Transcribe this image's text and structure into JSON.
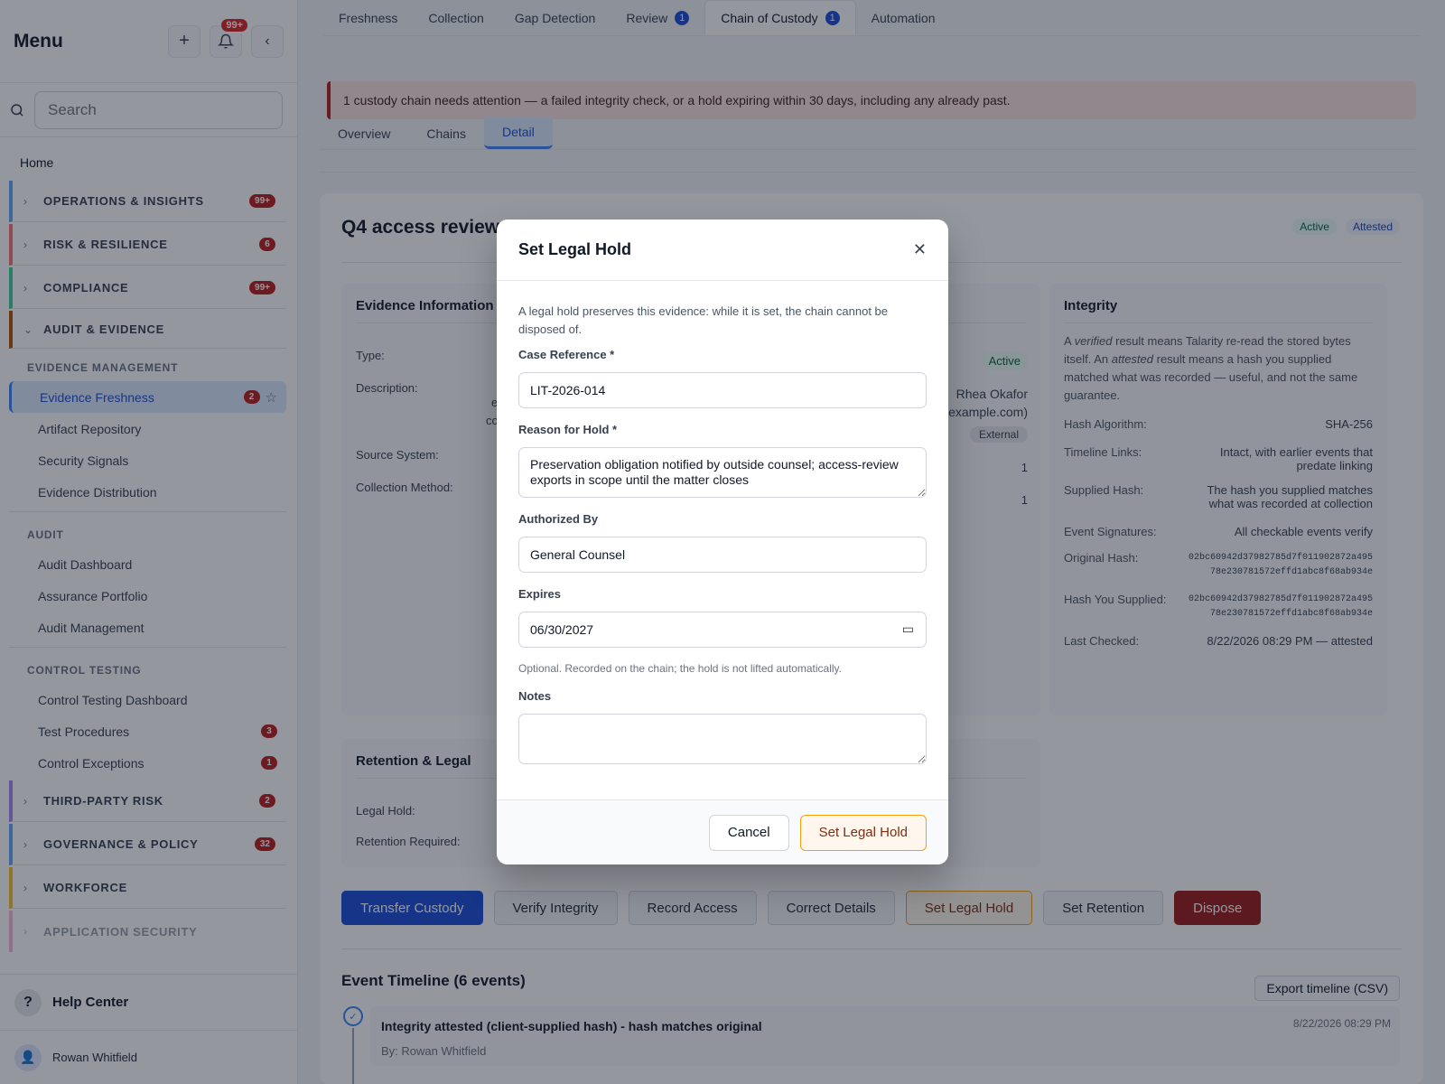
{
  "sidebar": {
    "title": "Menu",
    "notif_badge": "99+",
    "search_placeholder": "Search",
    "home": "Home",
    "groups": {
      "ops": {
        "label": "OPERATIONS & INSIGHTS",
        "badge": "99+",
        "color": "#60a5fa"
      },
      "risk": {
        "label": "RISK & RESILIENCE",
        "badge": "6",
        "color": "#f87171"
      },
      "compliance": {
        "label": "COMPLIANCE",
        "badge": "99+",
        "color": "#34d399"
      },
      "audit": {
        "label": "AUDIT & EVIDENCE",
        "color": "#b45309"
      },
      "tpr": {
        "label": "THIRD-PARTY RISK",
        "badge": "2",
        "color": "#a78bfa"
      },
      "gov": {
        "label": "GOVERNANCE & POLICY",
        "badge": "32",
        "color": "#60a5fa"
      },
      "work": {
        "label": "WORKFORCE",
        "color": "#fbbf24"
      },
      "appsec": {
        "label": "APPLICATION SECURITY",
        "color": "#f472b6"
      }
    },
    "sections": {
      "evidence": "EVIDENCE MANAGEMENT",
      "audit": "AUDIT",
      "ct": "CONTROL TESTING"
    },
    "items": {
      "freshness": {
        "label": "Evidence Freshness",
        "badge": "2"
      },
      "artifact": "Artifact Repository",
      "signals": "Security Signals",
      "distribution": "Evidence Distribution",
      "audit_dash": "Audit Dashboard",
      "assurance": "Assurance Portfolio",
      "audit_mgmt": "Audit Management",
      "ct_dash": "Control Testing Dashboard",
      "procedures": {
        "label": "Test Procedures",
        "badge": "3"
      },
      "exceptions": {
        "label": "Control Exceptions",
        "badge": "1"
      }
    },
    "help": "Help Center",
    "user": "Rowan Whitfield"
  },
  "tabs": [
    {
      "label": "Freshness"
    },
    {
      "label": "Collection"
    },
    {
      "label": "Gap Detection"
    },
    {
      "label": "Review",
      "count": "1"
    },
    {
      "label": "Chain of Custody",
      "count": "1"
    },
    {
      "label": "Automation"
    }
  ],
  "alert": "1 custody chain needs attention — a failed integrity check, or a hold expiring within 30 days, including any already past.",
  "subtabs": [
    "Overview",
    "Chains",
    "Detail"
  ],
  "chain": {
    "title": "Q4 access review",
    "pills": [
      "Active",
      "Attested"
    ],
    "evidence_panel": {
      "title": "Evidence Information",
      "type_label": "Type:",
      "desc_label": "Description:",
      "source_label": "Source System:",
      "method_label": "Collection Method:",
      "status": "Active",
      "owner": "Rhea Okafor",
      "email_frag": "example.com)",
      "tag": "External",
      "frag_e": "e",
      "frag_co": "co",
      "n1": "1",
      "n2": "1"
    },
    "integrity": {
      "title": "Integrity",
      "intro_a": "A ",
      "intro_verified": "verified",
      "intro_b": " result means Talarity re-read the stored bytes itself. An ",
      "intro_attested": "attested",
      "intro_c": " result means a hash you supplied matched what was recorded — useful, and not the same guarantee.",
      "hash_alg_label": "Hash Algorithm:",
      "hash_alg": "SHA-256",
      "links_label": "Timeline Links:",
      "links": "Intact, with earlier events that predate linking",
      "supplied_label": "Supplied Hash:",
      "supplied": "The hash you supplied matches what was recorded at collection",
      "sig_label": "Event Signatures:",
      "sig": "All checkable events verify",
      "orig_label": "Original Hash:",
      "orig_1": "02bc60942d37982785d7f011902872a495",
      "orig_2": "78e230781572effd1abc8f68ab934e",
      "you_label": "Hash You Supplied:",
      "you_1": "02bc60942d37982785d7f011902872a495",
      "you_2": "78e230781572effd1abc8f68ab934e",
      "last_label": "Last Checked:",
      "last": "8/22/2026 08:29 PM — attested"
    },
    "retention": {
      "title": "Retention & Legal",
      "hold_label": "Legal Hold:",
      "req_label": "Retention Required:"
    },
    "actions": [
      "Transfer Custody",
      "Verify Integrity",
      "Record Access",
      "Correct Details",
      "Set Legal Hold",
      "Set Retention",
      "Dispose"
    ],
    "timeline": {
      "title": "Event Timeline (6 events)",
      "export": "Export timeline (CSV)",
      "event_title": "Integrity attested (client-supplied hash) - hash matches original",
      "event_by": "By: Rowan Whitfield",
      "event_ts": "8/22/2026 08:29 PM"
    }
  },
  "modal": {
    "title": "Set Legal Hold",
    "intro": "A legal hold preserves this evidence: while it is set, the chain cannot be disposed of.",
    "case_label": "Case Reference *",
    "case_value": "LIT-2026-014",
    "reason_label": "Reason for Hold *",
    "reason_value": "Preservation obligation notified by outside counsel; access-review exports in scope until the matter closes",
    "auth_label": "Authorized By",
    "auth_value": "General Counsel",
    "expires_label": "Expires",
    "expires_value": "06/30/2027",
    "expires_hint": "Optional. Recorded on the chain; the hold is not lifted automatically.",
    "notes_label": "Notes",
    "notes_value": "",
    "cancel": "Cancel",
    "submit": "Set Legal Hold"
  }
}
